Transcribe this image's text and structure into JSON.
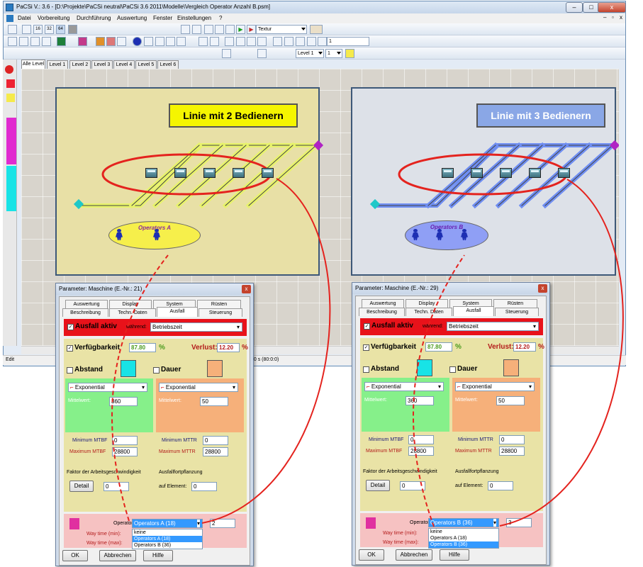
{
  "window": {
    "title": "PaCSi V.: 3.6 - [D:\\Projekte\\PaCSi neutral\\PaCSi 3.6 2011\\Modelle\\Vergleich Operator Anzahl B.psm]",
    "close_glyph": "x"
  },
  "menu": [
    "Datei",
    "Vorbereitung",
    "Durchführung",
    "Auswertung",
    "Fenster",
    "Einstellungen",
    "?"
  ],
  "toolbar": {
    "view_sizes": [
      "16",
      "32",
      "64"
    ],
    "texture_combo": "Textur",
    "spin_value": "1",
    "level_combo": "Level 1",
    "level_num": "1"
  },
  "level_tabs": [
    "Alle Level",
    "Level 1",
    "Level 2",
    "Level 3",
    "Level 4",
    "Level 5",
    "Level 6"
  ],
  "status": {
    "left": "Edit",
    "right": "00 s  (80:0:0)"
  },
  "lines": [
    {
      "label": "Linie mit 2 Bedienern",
      "operators_label": "Operators A",
      "operator_count": 2,
      "label_bg": "#f5f500",
      "area_bg": "#e8e0a6",
      "track_color": "#e8f36b",
      "oval_bg": "#f6ef4b"
    },
    {
      "label": "Linie mit 3 Bedienern",
      "operators_label": "Operators B",
      "operator_count": 3,
      "label_bg": "#8aa7e6",
      "area_bg": "#dde1e8",
      "track_color": "#6f8ef2",
      "oval_bg": "#8f9ff5"
    }
  ],
  "dialogs": [
    {
      "title": "Parameter: Maschine (E.-Nr.:  21)",
      "tabs_row1": [
        "Auswertung",
        "Display",
        "System",
        "Rüsten"
      ],
      "tabs_row2": [
        "Beschreibung",
        "Techn. Daten",
        "Ausfall",
        "Steuerung"
      ],
      "ausfall_label": "Ausfall aktiv",
      "waehrend_label": "während:",
      "waehrend_value": "Betriebszeit",
      "verfuegbarkeit_label": "Verfügbarkeit",
      "verfuegbarkeit_value": "87.80",
      "verlust_label": "Verlust:",
      "verlust_value": "12.20",
      "percent": "%",
      "abstand_label": "Abstand",
      "dauer_label": "Dauer",
      "dist_left": "Exponential",
      "dist_right": "Exponential",
      "mittelwert_label": "Mittelwert:",
      "mittelwert_left": "360",
      "mittelwert_right": "50",
      "min_mtbf_label": "Minimum MTBF",
      "min_mtbf": "0",
      "max_mtbf_label": "Maximum MTBF",
      "max_mtbf": "28800",
      "min_mttr_label": "Minimum MTTR",
      "min_mttr": "0",
      "max_mttr_label": "Maximum MTTR",
      "max_mttr": "28800",
      "faktor_label": "Faktor der Arbeitsgeschwindigkeit",
      "detail_button": "Detail",
      "faktor_value": "0",
      "ausfall_fort_label": "Ausfallfortpflanzung",
      "auf_element_label": "auf Element:",
      "auf_element": "0",
      "operator_label": "Operator:",
      "operator_value": "Operators A (18)",
      "operator_count": "2",
      "way_min_label": "Way time (min):",
      "way_max_label": "Way time (max):",
      "dropdown": [
        "keine",
        "Operators A (18)",
        "Operators B (36)"
      ],
      "dropdown_selected": 1,
      "ok": "OK",
      "cancel": "Abbrechen",
      "help": "Hilfe"
    },
    {
      "title": "Parameter: Maschine (E.-Nr.:  29)",
      "tabs_row1": [
        "Auswertung",
        "Display",
        "System",
        "Rüsten"
      ],
      "tabs_row2": [
        "Beschreibung",
        "Techn. Daten",
        "Ausfall",
        "Steuerung"
      ],
      "ausfall_label": "Ausfall aktiv",
      "waehrend_label": "während:",
      "waehrend_value": "Betriebszeit",
      "verfuegbarkeit_label": "Verfügbarkeit",
      "verfuegbarkeit_value": "87.80",
      "verlust_label": "Verlust:",
      "verlust_value": "12.20",
      "percent": "%",
      "abstand_label": "Abstand",
      "dauer_label": "Dauer",
      "dist_left": "Exponential",
      "dist_right": "Exponential",
      "mittelwert_label": "Mittelwert:",
      "mittelwert_left": "360",
      "mittelwert_right": "50",
      "min_mtbf_label": "Minimum MTBF",
      "min_mtbf": "0",
      "max_mtbf_label": "Maximum MTBF",
      "max_mtbf": "28800",
      "min_mttr_label": "Minimum MTTR",
      "min_mttr": "0",
      "max_mttr_label": "Maximum MTTR",
      "max_mttr": "28800",
      "faktor_label": "Faktor der Arbeitsgeschwindigkeit",
      "detail_button": "Detail",
      "faktor_value": "0",
      "ausfall_fort_label": "Ausfallfortpflanzung",
      "auf_element_label": "auf Element:",
      "auf_element": "0",
      "operator_label": "Operator:",
      "operator_value": "Operators B (36)",
      "operator_count": "3",
      "way_min_label": "Way time (min):",
      "way_max_label": "Way time (max):",
      "dropdown": [
        "keine",
        "Operators A (18)",
        "Operators B (36)"
      ],
      "dropdown_selected": 2,
      "ok": "OK",
      "cancel": "Abbrechen",
      "help": "Hilfe"
    }
  ],
  "colors": {
    "annotation": "#e4231e",
    "ausfall_bar": "#e8121a",
    "green_panel": "#86f08a",
    "orange_panel": "#f6b07a",
    "khaki": "#e9e3a6",
    "pink": "#f6c2c2"
  }
}
